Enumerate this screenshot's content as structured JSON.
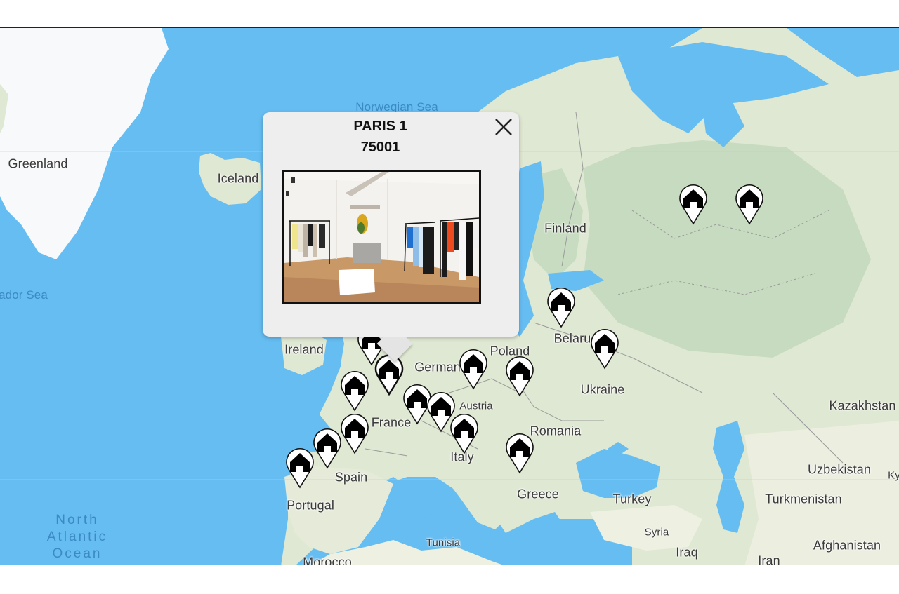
{
  "map": {
    "colors": {
      "water": "#66bdf1",
      "land": "#dfe8d2",
      "forest": "#c3d9bd",
      "ice": "#f8f9fa",
      "label": "#3a3a3a",
      "water_label": "#3b8ac4"
    },
    "labels": [
      {
        "id": "greenland",
        "text": "Greenland",
        "type": "land"
      },
      {
        "id": "iceland",
        "text": "Iceland",
        "type": "land"
      },
      {
        "id": "norwegian-sea",
        "text": "Norwegian Sea",
        "type": "water"
      },
      {
        "id": "labrador-sea",
        "text": "ador Sea",
        "type": "water"
      },
      {
        "id": "finland",
        "text": "Finland",
        "type": "land"
      },
      {
        "id": "ireland",
        "text": "Ireland",
        "type": "land"
      },
      {
        "id": "belarus",
        "text": "Belaru",
        "type": "land"
      },
      {
        "id": "poland",
        "text": "Poland",
        "type": "land"
      },
      {
        "id": "germany",
        "text": "German",
        "type": "land"
      },
      {
        "id": "ukraine",
        "text": "Ukraine",
        "type": "land"
      },
      {
        "id": "kazakhstan",
        "text": "Kazakhstan",
        "type": "land"
      },
      {
        "id": "austria",
        "text": "Austria",
        "type": "small"
      },
      {
        "id": "france",
        "text": "France",
        "type": "land"
      },
      {
        "id": "romania",
        "text": "Romania",
        "type": "land"
      },
      {
        "id": "italy",
        "text": "Italy",
        "type": "land"
      },
      {
        "id": "spain",
        "text": "Spain",
        "type": "land"
      },
      {
        "id": "portugal",
        "text": "Portugal",
        "type": "land"
      },
      {
        "id": "uzbekistan",
        "text": "Uzbekistan",
        "type": "land"
      },
      {
        "id": "kyrgyzstan",
        "text": "Ky",
        "type": "small"
      },
      {
        "id": "greece",
        "text": "Greece",
        "type": "land"
      },
      {
        "id": "turkey",
        "text": "Turkey",
        "type": "land"
      },
      {
        "id": "turkmenistan",
        "text": "Turkmenistan",
        "type": "land"
      },
      {
        "id": "syria",
        "text": "Syria",
        "type": "small"
      },
      {
        "id": "iraq",
        "text": "Iraq",
        "type": "land"
      },
      {
        "id": "iran",
        "text": "Iran",
        "type": "land"
      },
      {
        "id": "afghanistan",
        "text": "Afghanistan",
        "type": "land"
      },
      {
        "id": "tunisia",
        "text": "Tunisia",
        "type": "small"
      },
      {
        "id": "morocco",
        "text": "Morocco",
        "type": "land"
      },
      {
        "id": "north-atlantic",
        "text": "North\nAtlantic\nOcean",
        "type": "ocean"
      }
    ],
    "markers": [
      {
        "id": "russia-1",
        "icon": "house-icon"
      },
      {
        "id": "russia-2",
        "icon": "house-icon"
      },
      {
        "id": "baltic",
        "icon": "house-icon"
      },
      {
        "id": "belarus",
        "icon": "house-icon"
      },
      {
        "id": "uk",
        "icon": "house-icon"
      },
      {
        "id": "paris-1",
        "icon": "house-icon",
        "selected": true
      },
      {
        "id": "germany",
        "icon": "house-icon"
      },
      {
        "id": "poland",
        "icon": "house-icon"
      },
      {
        "id": "brittany",
        "icon": "house-icon"
      },
      {
        "id": "switzerland",
        "icon": "house-icon"
      },
      {
        "id": "austria",
        "icon": "house-icon"
      },
      {
        "id": "bordeaux",
        "icon": "house-icon"
      },
      {
        "id": "italy",
        "icon": "house-icon"
      },
      {
        "id": "balkans",
        "icon": "house-icon"
      },
      {
        "id": "north-spain",
        "icon": "house-icon"
      },
      {
        "id": "portugal",
        "icon": "house-icon"
      }
    ]
  },
  "popup": {
    "title": "PARIS 1",
    "subtitle": "75001",
    "close_icon": "close-icon",
    "image_alt": "Store interior with clothing racks"
  }
}
